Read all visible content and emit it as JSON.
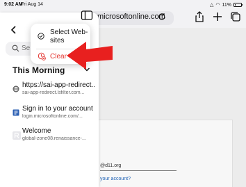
{
  "status_bar": {
    "time": "9:02 AM",
    "date": "Fri Aug 14",
    "signal": "△",
    "wifi": "◠",
    "battery_text": "11%",
    "battery_level": 0.11
  },
  "toolbar": {
    "address_text": "microsoftonline.com"
  },
  "sidebar": {
    "search_placeholder": "Se",
    "section_title": "This Morning",
    "history": [
      {
        "title": "https://sai-app-redirect...",
        "url": "sai-app-redirect.lsfilter.com..."
      },
      {
        "title": "Sign in to your account",
        "url": "login.microsoftonline.com/..."
      },
      {
        "title": "Welcome",
        "url": "global-zone08.renaissance-..."
      }
    ]
  },
  "menu": {
    "select_label": "Select Web-sites",
    "clear_label": "Clear"
  },
  "page": {
    "email_fragment": "@d11.org",
    "account_link": "your account?"
  },
  "colors": {
    "accent_red": "#e3342f",
    "annotation_red": "#e8201f"
  }
}
